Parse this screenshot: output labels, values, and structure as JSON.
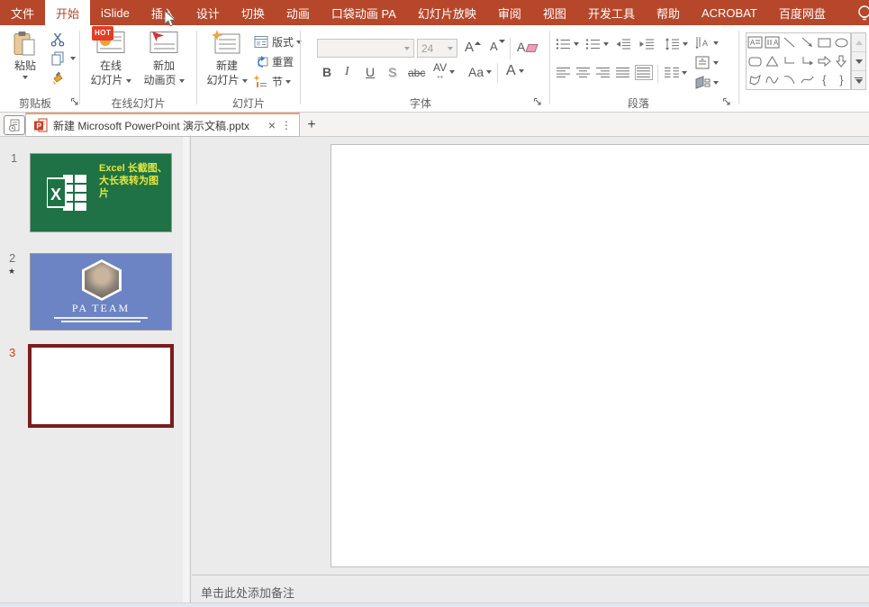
{
  "menubar": {
    "tabs": [
      {
        "label": "文件"
      },
      {
        "label": "开始",
        "active": true
      },
      {
        "label": "iSlide"
      },
      {
        "label": "插入"
      },
      {
        "label": "设计"
      },
      {
        "label": "切换"
      },
      {
        "label": "动画"
      },
      {
        "label": "口袋动画 PA"
      },
      {
        "label": "幻灯片放映"
      },
      {
        "label": "审阅"
      },
      {
        "label": "视图"
      },
      {
        "label": "开发工具"
      },
      {
        "label": "帮助"
      },
      {
        "label": "ACROBAT"
      },
      {
        "label": "百度网盘"
      }
    ]
  },
  "ribbon": {
    "clipboard": {
      "group_label": "剪贴板",
      "paste_label": "粘贴"
    },
    "online_slides": {
      "group_label": "在线幻灯片",
      "hot_badge": "HOT",
      "btn1_line1": "在线",
      "btn1_line2": "幻灯片",
      "btn2_line1": "新加",
      "btn2_line2": "动画页"
    },
    "slides": {
      "group_label": "幻灯片",
      "new_line1": "新建",
      "new_line2": "幻灯片",
      "layout_label": "版式",
      "reset_label": "重置",
      "section_label": "节"
    },
    "font": {
      "group_label": "字体",
      "font_size": "24",
      "bold": "B",
      "italic": "I",
      "underline": "U",
      "shadow": "S",
      "strikethrough": "abc",
      "char_spacing": "AV",
      "spacing_arrow": "↔",
      "change_case": "Aa",
      "font_color": "A",
      "grow_letter": "A",
      "shrink_letter": "A",
      "clear_letter": "A"
    },
    "paragraph": {
      "group_label": "段落"
    },
    "drawing": {
      "brace_left": "{",
      "brace_right": "}"
    }
  },
  "tabbar": {
    "doc_title": "新建 Microsoft PowerPoint 演示文稿.pptx",
    "ppt_icon_letter": "P",
    "close_glyph": "×",
    "menu_glyph": "⋮",
    "new_tab_glyph": "+"
  },
  "thumbnail_panel": {
    "slide1": {
      "num": "1",
      "text": "Excel 长截图、大长表转为图片",
      "excel_logo_letter": "X"
    },
    "slide2": {
      "num": "2",
      "star_glyph": "★",
      "title": "PA TEAM"
    },
    "slide3": {
      "num": "3"
    }
  },
  "notes": {
    "placeholder": "单击此处添加备注"
  },
  "icons": {
    "paste": "clipboard",
    "cut": "scissors",
    "copy": "two-pages",
    "format_painter": "brush",
    "online_slide": "slide-with-pie-chart",
    "new_anim_page": "slide-with-paper-plane",
    "new_slide": "slide-with-sparkle",
    "layout": "layout-frame",
    "reset": "slide-undo-arrow",
    "section": "section-bracket",
    "tell_me": "lightbulb",
    "doc_tab_list": "page-with-clock"
  },
  "colors": {
    "accent_red": "#B7472A",
    "hot_badge_bg": "#E63C25",
    "slide1_bg": "#1E7245",
    "slide1_text": "#E6E63C",
    "slide2_bg": "#6C84C4",
    "selected_thumb_border": "#7A1D1D",
    "selected_num": "#C8401A",
    "active_tab_top": "#EE9D72"
  }
}
